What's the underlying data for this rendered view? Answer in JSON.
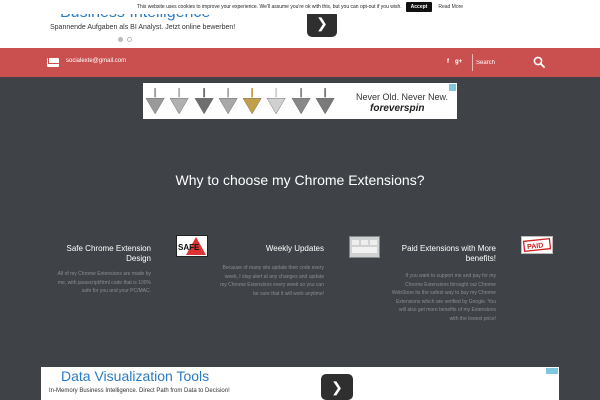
{
  "top_ad": {
    "title": "Business Intelligence",
    "subtitle": "Spannende Aufgaben als BI Analyst. Jetzt online bewerben!",
    "next_glyph": "❯"
  },
  "cookie": {
    "message": "This website uses cookies to improve your experience. We'll assume you're ok with this, but you can opt-out if you wish.",
    "accept_label": "Accept",
    "read_more_label": "Read More"
  },
  "header": {
    "email": "socialexte@gmail.com",
    "social": [
      "f",
      "g+"
    ],
    "search_placeholder": "Search"
  },
  "banner_ad": {
    "slogan": "Never Old. Never New.",
    "brand": "foreverspin",
    "top_colors": [
      "#9a9a9a",
      "#b0b0b0",
      "#6e6e6e",
      "#a8a8a8",
      "#c2a04a",
      "#d0d0d0",
      "#888888",
      "#7a7a7a"
    ]
  },
  "section": {
    "title": "Why to choose my Chrome Extensions?"
  },
  "features": [
    {
      "title": "Safe Chrome Extension Design",
      "text": "All of my Chrome Extensions are made by me, with javascript/html code that is 100% safe for you and your PC/MAC.",
      "icon": "safe-sign-icon"
    },
    {
      "title": "Weekly Updates",
      "text": "Because of many site update their code every week, I stay alert at any changes and update my Chrome Extensions every week so you can be sure that it will work anytime!",
      "icon": "keyboard-icon"
    },
    {
      "title": "Paid Extensions with More benefits!",
      "text": "If you want to support me and pay for my Chrome Extensions throught out Chrome WebStore its the safest way to buy my Chrome Extensions which are verified by Google. You will also get more benefits of my Extensions with the lowest price!",
      "icon": "paid-stamp-icon"
    }
  ],
  "icons": {
    "safe_label": "SAFE",
    "paid_label": "PAID"
  },
  "bottom_ad": {
    "title": "Data Visualization Tools",
    "subtitle": "In-Memory Business Intelligence. Direct Path from Data to Decision!",
    "next_glyph": "❯"
  },
  "colors": {
    "header_red": "#c9504f",
    "page_bg": "#3f4347",
    "ad_blue": "#2b7bc1"
  }
}
